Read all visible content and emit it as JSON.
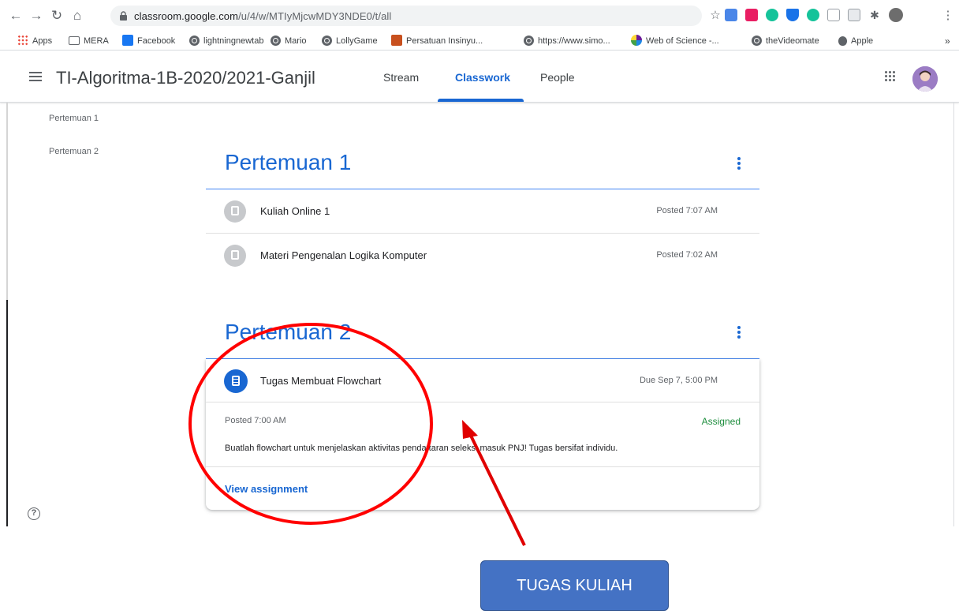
{
  "browser": {
    "url_host": "classroom.google.com",
    "url_path": "/u/4/w/MTIyMjcwMDY3NDE0/t/all",
    "bookmarks": [
      "Apps",
      "MERA",
      "Facebook",
      "lightningnewtab",
      "Mario",
      "LollyGame",
      "Persatuan Insinyu...",
      "https://www.simo...",
      "Web of Science -...",
      "theVideomate",
      "Apple"
    ],
    "overflow": "»"
  },
  "header": {
    "class_title": "TI-Algoritma-1B-2020/2021-Ganjil",
    "tabs": [
      "Stream",
      "Classwork",
      "People"
    ],
    "active_tab": "Classwork"
  },
  "sidebar": {
    "topics": [
      "Pertemuan 1",
      "Pertemuan 2"
    ],
    "help_glyph": "?"
  },
  "topics": [
    {
      "title": "Pertemuan 1",
      "items": [
        {
          "title": "Kuliah Online 1",
          "time": "Posted 7:07 AM",
          "icon": "material-icon"
        },
        {
          "title": "Materi Pengenalan Logika Komputer",
          "time": "Posted 7:02 AM",
          "icon": "material-icon"
        }
      ]
    },
    {
      "title": "Pertemuan 2",
      "assignment": {
        "title": "Tugas Membuat Flowchart",
        "due": "Due Sep 7, 5:00 PM",
        "posted": "Posted 7:00 AM",
        "status": "Assigned",
        "description": "Buatlah flowchart untuk menjelaskan aktivitas pendaftaran seleksi masuk PNJ! Tugas bersifat individu.",
        "link": "View assignment",
        "icon": "assignment-icon"
      }
    }
  ],
  "annotation": {
    "callout": "TUGAS KULIAH",
    "circle_color": "#ff0000",
    "arrow_color": "#e00000"
  },
  "colors": {
    "accent": "#1967d2",
    "assigned": "#1e8e3e",
    "callout_bg": "#4472c4"
  }
}
